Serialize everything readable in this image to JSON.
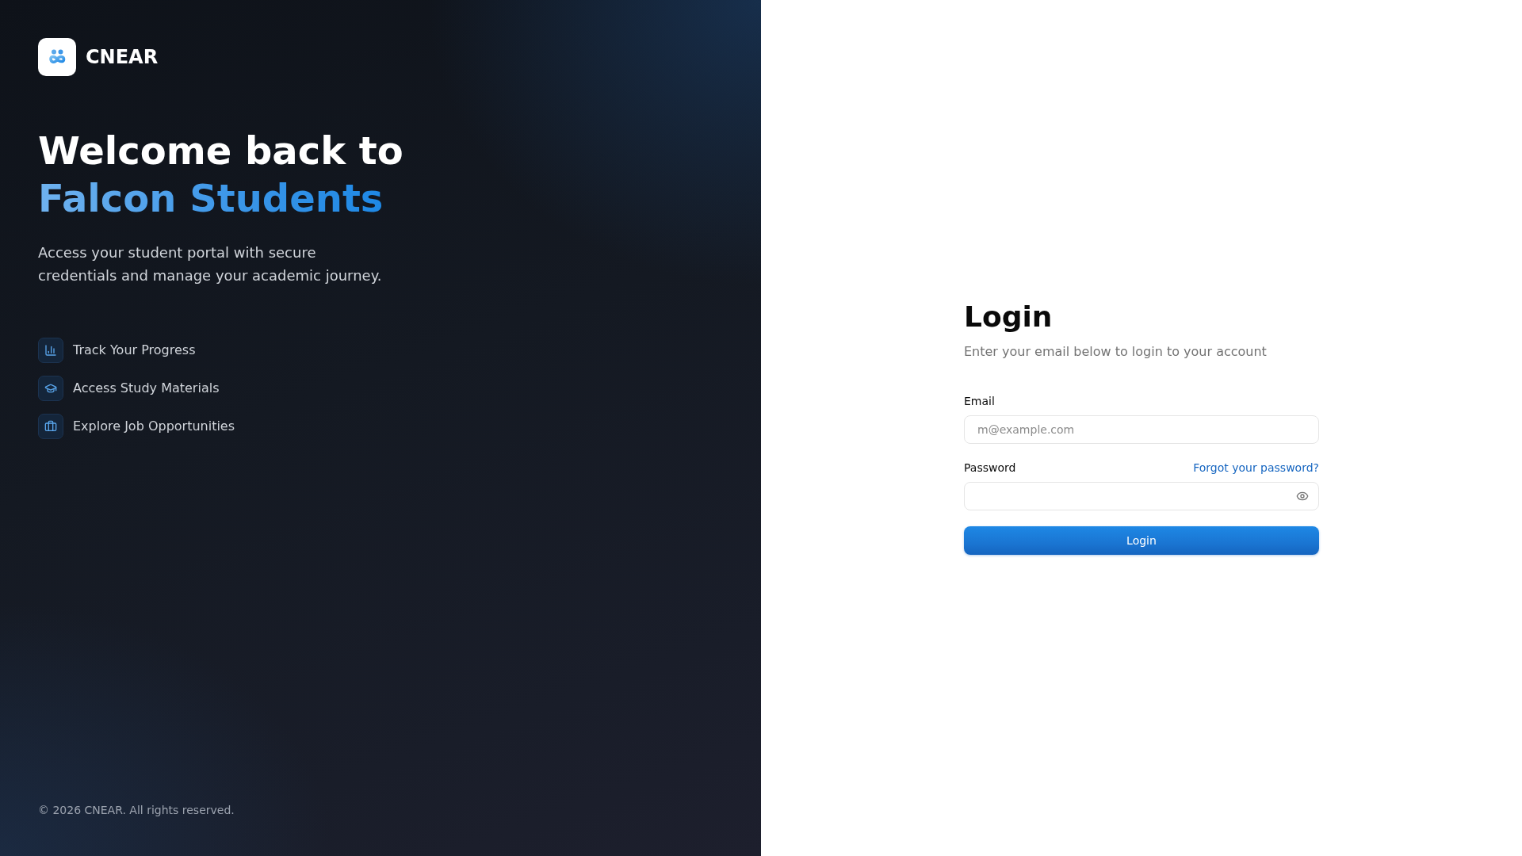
{
  "brand": {
    "name": "CNEAR"
  },
  "hero": {
    "title_line_1": "Welcome back to",
    "title_line_2": "Falcon Students",
    "subtitle": "Access your student portal with secure credentials and manage your academic journey."
  },
  "features": [
    {
      "kind": "chart",
      "label": "Track Your Progress"
    },
    {
      "kind": "cap",
      "label": "Access Study Materials"
    },
    {
      "kind": "briefcase",
      "label": "Explore Job Opportunities"
    }
  ],
  "footer": {
    "copyright": "© 2026 CNEAR. All rights reserved."
  },
  "login": {
    "title": "Login",
    "subtitle": "Enter your email below to login to your account",
    "email": {
      "label": "Email",
      "placeholder": "m@example.com"
    },
    "password": {
      "label": "Password",
      "forgot_link": "Forgot your password?"
    },
    "submit": "Login"
  }
}
